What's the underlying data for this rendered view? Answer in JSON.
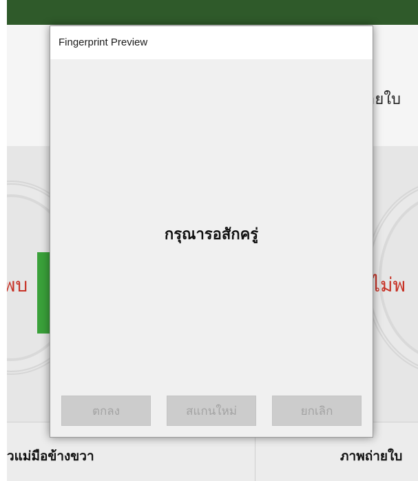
{
  "background_app": {
    "right_panel_title": "ายใบ",
    "left_status": "พบ",
    "right_status": "ไม่พ",
    "bottom_left_label": "วแม่มือข้างขวา",
    "bottom_right_label": "ภาพถ่ายใบ",
    "colors": {
      "topbar": "#2f5a2a",
      "status_red": "#c73226",
      "button_green": "#3aa13a"
    }
  },
  "dialog": {
    "title": "Fingerprint Preview",
    "message": "กรุณารอสักครู่",
    "buttons": {
      "ok": "ตกลง",
      "rescan": "สแกนใหม่",
      "cancel": "ยกเลิก"
    }
  },
  "icons": [
    "seal-emblem-icon"
  ]
}
